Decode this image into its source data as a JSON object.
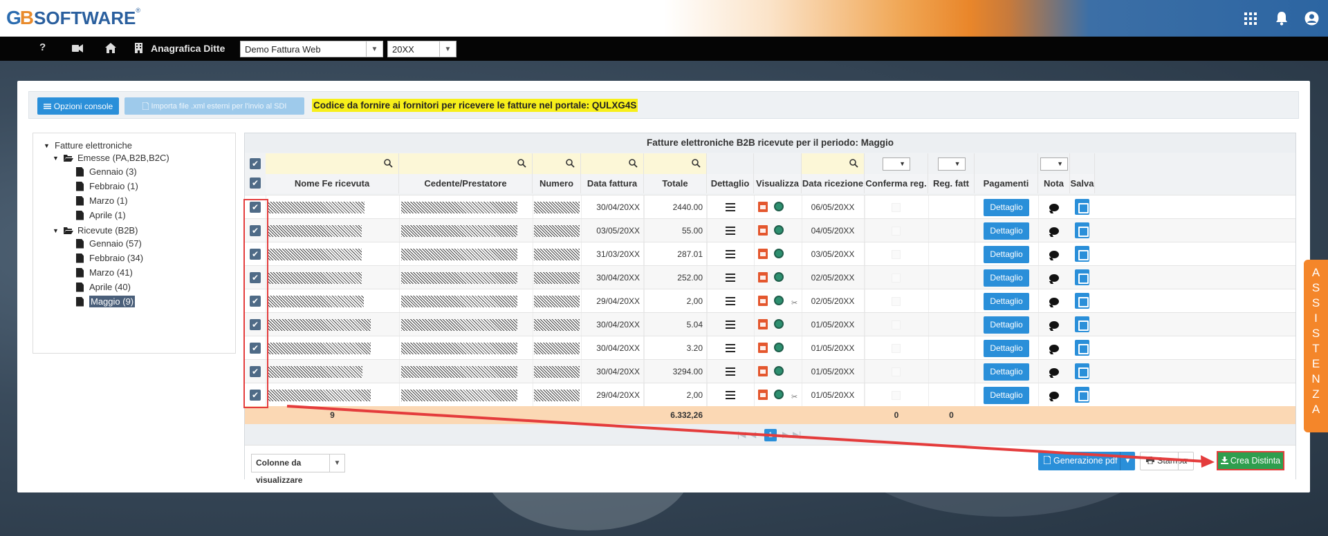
{
  "header": {
    "logo": {
      "g": "G",
      "b": "B",
      "text": "SOFTWARE",
      "reg": "®"
    },
    "icons": [
      "grid-icon",
      "bell-icon",
      "user-icon"
    ]
  },
  "nav": {
    "help": "?",
    "title": "Anagrafica Ditte",
    "company_select": "Demo Fattura Web",
    "year_select": "20XX"
  },
  "toolbar": {
    "options_label": "Opzioni console",
    "import_label": "Importa file .xml esterni per l'invio al SDI",
    "portal_code_text": "Codice da fornire ai fornitori per ricevere le fatture nel portale: QULXG4S"
  },
  "tree": {
    "root": "Fatture elettroniche",
    "emesse": {
      "label": "Emesse (PA,B2B,B2C)",
      "months": [
        "Gennaio (3)",
        "Febbraio (1)",
        "Marzo (1)",
        "Aprile (1)"
      ]
    },
    "ricevute": {
      "label": "Ricevute (B2B)",
      "months": [
        "Gennaio (57)",
        "Febbraio (34)",
        "Marzo (41)",
        "Aprile (40)",
        "Maggio (9)"
      ],
      "selected": "Maggio (9)"
    }
  },
  "grid": {
    "title": "Fatture elettroniche B2B ricevute per il periodo: Maggio",
    "columns": [
      "Nome Fe ricevuta",
      "Cedente/Prestatore",
      "Numero",
      "Data fattura",
      "Totale",
      "Dettaglio",
      "Visualizza",
      "Data ricezione",
      "Conferma reg.",
      "Reg. fatt",
      "Pagamenti",
      "Nota",
      "Salva"
    ],
    "detail_button_label": "Dettaglio",
    "rows": [
      {
        "data_fattura": "30/04/20XX",
        "totale": "2440.00",
        "data_ricezione": "06/05/20XX",
        "attachment": false
      },
      {
        "data_fattura": "03/05/20XX",
        "totale": "55.00",
        "data_ricezione": "04/05/20XX",
        "attachment": false
      },
      {
        "data_fattura": "31/03/20XX",
        "totale": "287.01",
        "data_ricezione": "03/05/20XX",
        "attachment": false
      },
      {
        "data_fattura": "30/04/20XX",
        "totale": "252.00",
        "data_ricezione": "02/05/20XX",
        "attachment": false
      },
      {
        "data_fattura": "29/04/20XX",
        "totale": "2,00",
        "data_ricezione": "02/05/20XX",
        "attachment": true
      },
      {
        "data_fattura": "30/04/20XX",
        "totale": "5.04",
        "data_ricezione": "01/05/20XX",
        "attachment": false
      },
      {
        "data_fattura": "30/04/20XX",
        "totale": "3.20",
        "data_ricezione": "01/05/20XX",
        "attachment": false
      },
      {
        "data_fattura": "30/04/20XX",
        "totale": "3294.00",
        "data_ricezione": "01/05/20XX",
        "attachment": false
      },
      {
        "data_fattura": "29/04/20XX",
        "totale": "2,00",
        "data_ricezione": "01/05/20XX",
        "attachment": true
      }
    ],
    "totals": {
      "count": "9",
      "totale": "6.332,26",
      "conferma": "0",
      "reg_fatt": "0"
    },
    "pager": {
      "current_page": "1"
    }
  },
  "footer": {
    "columns_label": "Colonne da visualizzare",
    "pdf_label": "Generazione pdf",
    "print_label": "Stampa",
    "create_label": "Crea Distinta"
  },
  "assist": {
    "letters": [
      "A",
      "S",
      "S",
      "I",
      "S",
      "T",
      "E",
      "N",
      "Z",
      "A"
    ]
  },
  "colors": {
    "accent": "#2a8fd9",
    "highlight": "#f7ef1a",
    "totals_bg": "#fbd8b4",
    "assist": "#f4862a",
    "annotation": "#e43c3c"
  }
}
